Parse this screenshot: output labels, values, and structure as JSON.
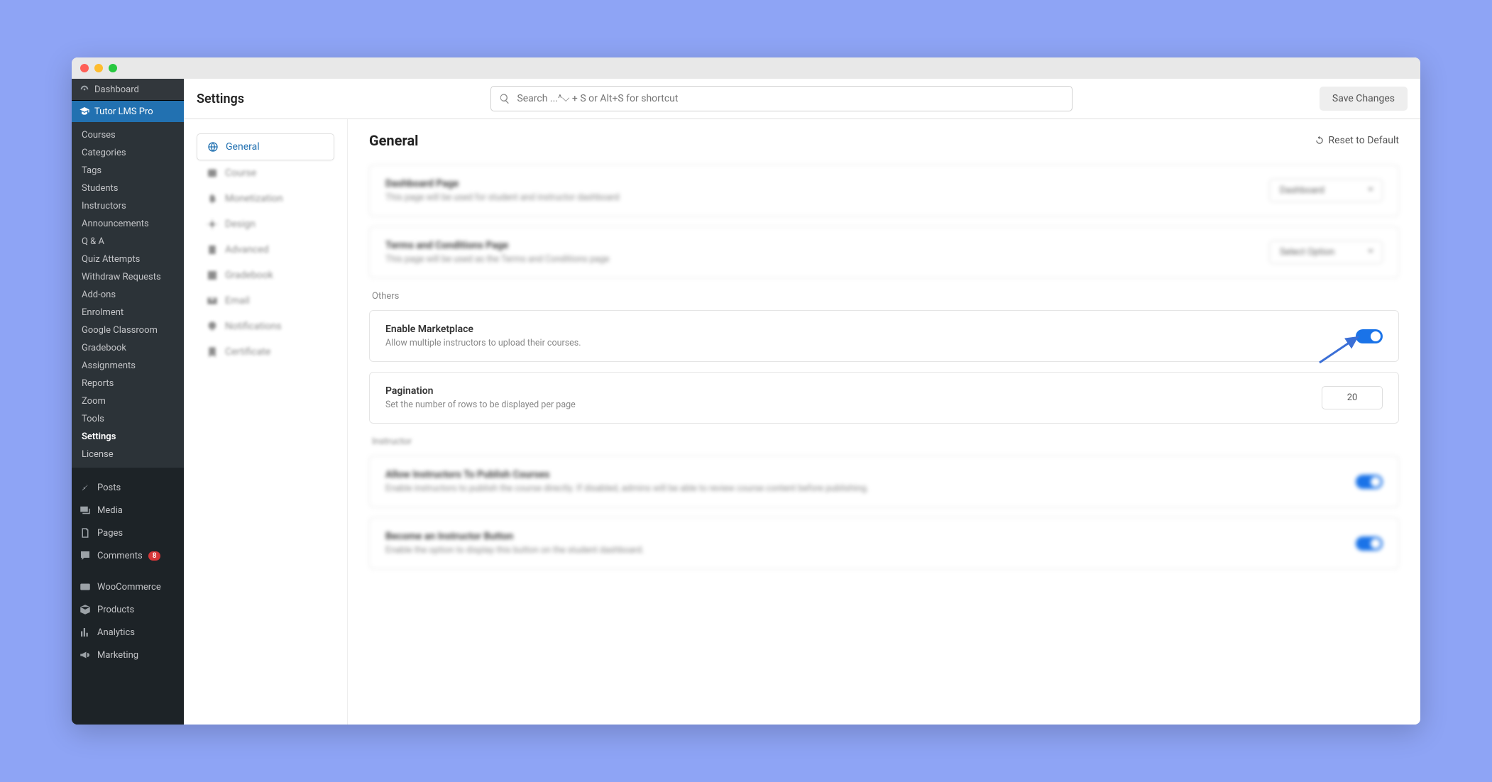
{
  "header": {
    "title": "Settings",
    "search_placeholder": "Search ...^⌵ + S or Alt+S for shortcut",
    "save_label": "Save Changes"
  },
  "sidebar": {
    "dashboard": "Dashboard",
    "plugin": "Tutor LMS Pro",
    "sub": [
      "Courses",
      "Categories",
      "Tags",
      "Students",
      "Instructors",
      "Announcements",
      "Q & A",
      "Quiz Attempts",
      "Withdraw Requests",
      "Add-ons",
      "Enrolment",
      "Google Classroom",
      "Gradebook",
      "Assignments",
      "Reports",
      "Zoom",
      "Tools",
      "Settings",
      "License"
    ],
    "active_sub": "Settings",
    "main": [
      {
        "label": "Posts",
        "icon": "pin"
      },
      {
        "label": "Media",
        "icon": "media"
      },
      {
        "label": "Pages",
        "icon": "page"
      },
      {
        "label": "Comments",
        "icon": "comment",
        "badge": "8"
      },
      {
        "label": "WooCommerce",
        "icon": "woo"
      },
      {
        "label": "Products",
        "icon": "box"
      },
      {
        "label": "Analytics",
        "icon": "chart"
      },
      {
        "label": "Marketing",
        "icon": "horn"
      }
    ]
  },
  "tabs": [
    "General",
    "Course",
    "Monetization",
    "Design",
    "Advanced",
    "Gradebook",
    "Email",
    "Notifications",
    "Certificate"
  ],
  "main": {
    "title": "General",
    "reset": "Reset to Default",
    "cards": {
      "dashboard_page": {
        "title": "Dashboard Page",
        "desc": "This page will be used for student and instructor dashboard",
        "select": "Dashboard"
      },
      "terms_page": {
        "title": "Terms and Conditions Page",
        "desc": "This page will be used as the Terms and Conditions page",
        "select": "Select Option"
      },
      "others_label": "Others",
      "marketplace": {
        "title": "Enable Marketplace",
        "desc": "Allow multiple instructors to upload their courses."
      },
      "pagination": {
        "title": "Pagination",
        "desc": "Set the number of rows to be displayed per page",
        "value": "20"
      },
      "instructor_label": "Instructor",
      "allow_publish": {
        "title": "Allow Instructors To Publish Courses",
        "desc": "Enable instructors to publish the course directly. If disabled, admins will be able to review course content before publishing."
      },
      "become_instructor": {
        "title": "Become an Instructor Button",
        "desc": "Enable the option to display this button on the student dashboard."
      }
    }
  }
}
